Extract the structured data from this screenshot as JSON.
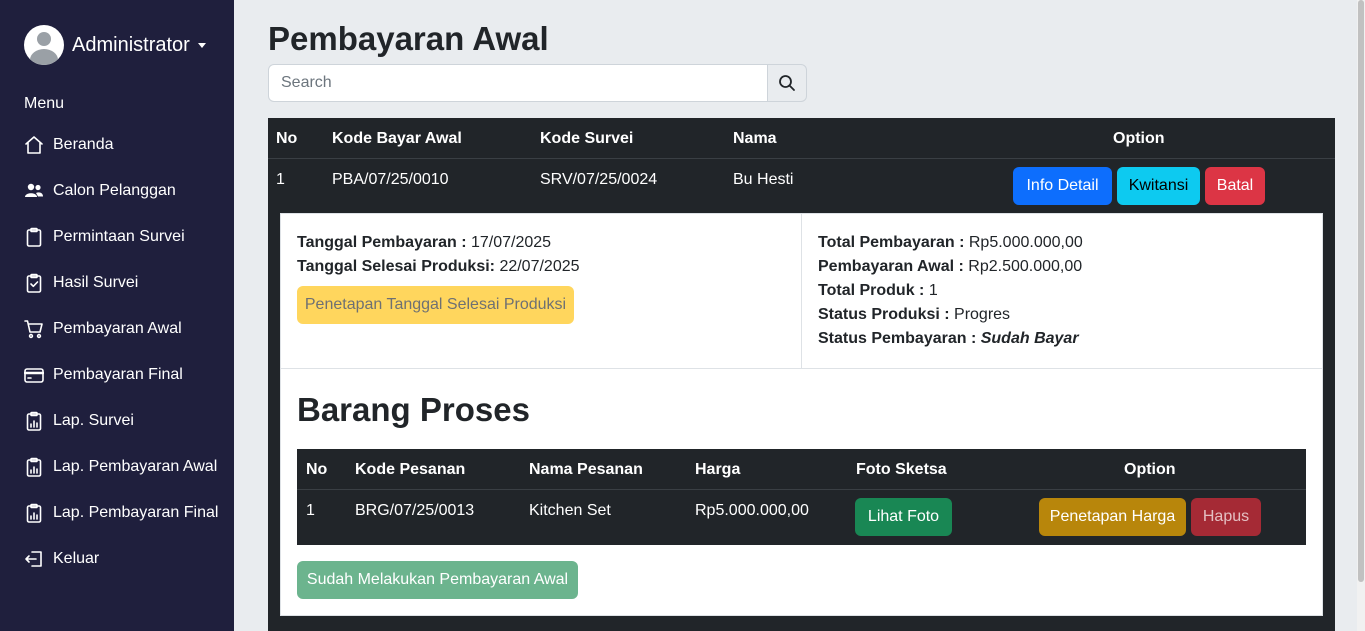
{
  "sidebar": {
    "user_name": "Administrator",
    "menu_title": "Menu",
    "items": [
      {
        "label": "Beranda",
        "icon": "home-icon"
      },
      {
        "label": "Calon Pelanggan",
        "icon": "people-icon"
      },
      {
        "label": "Permintaan Survei",
        "icon": "clipboard-icon"
      },
      {
        "label": "Hasil Survei",
        "icon": "clipboard-check-icon"
      },
      {
        "label": "Pembayaran Awal",
        "icon": "cart-icon"
      },
      {
        "label": "Pembayaran Final",
        "icon": "credit-card-icon"
      },
      {
        "label": "Lap. Survei",
        "icon": "report-icon"
      },
      {
        "label": "Lap. Pembayaran Awal",
        "icon": "report-icon"
      },
      {
        "label": "Lap. Pembayaran Final",
        "icon": "report-icon"
      },
      {
        "label": "Keluar",
        "icon": "logout-icon"
      }
    ]
  },
  "page": {
    "title": "Pembayaran Awal",
    "search_placeholder": "Search"
  },
  "main_table": {
    "headers": [
      "No",
      "Kode Bayar Awal",
      "Kode Survei",
      "Nama",
      "Option"
    ],
    "rows": [
      {
        "no": "1",
        "kode_bayar_awal": "PBA/07/25/0010",
        "kode_survei": "SRV/07/25/0024",
        "nama": "Bu Hesti"
      }
    ],
    "buttons": {
      "info_detail": "Info Detail",
      "kwitansi": "Kwitansi",
      "batal": "Batal"
    }
  },
  "detail": {
    "tanggal_pembayaran_label": "Tanggal Pembayaran :",
    "tanggal_pembayaran": "17/07/2025",
    "tanggal_selesai_label": "Tanggal Selesai Produksi:",
    "tanggal_selesai": "22/07/2025",
    "penetapan_tanggal_button": "Penetapan Tanggal Selesai Produksi",
    "total_pembayaran_label": "Total Pembayaran :",
    "total_pembayaran": "Rp5.000.000,00",
    "pembayaran_awal_label": "Pembayaran Awal :",
    "pembayaran_awal": "Rp2.500.000,00",
    "total_produk_label": "Total Produk :",
    "total_produk": "1",
    "status_produksi_label": "Status Produksi :",
    "status_produksi": "Progres",
    "status_pembayaran_label": "Status Pembayaran :",
    "status_pembayaran": "Sudah Bayar"
  },
  "barang": {
    "title": "Barang Proses",
    "headers": [
      "No",
      "Kode Pesanan",
      "Nama Pesanan",
      "Harga",
      "Foto Sketsa",
      "Option"
    ],
    "rows": [
      {
        "no": "1",
        "kode_pesanan": "BRG/07/25/0013",
        "nama_pesanan": "Kitchen Set",
        "harga": "Rp5.000.000,00"
      }
    ],
    "buttons": {
      "lihat_foto": "Lihat Foto",
      "penetapan_harga": "Penetapan Harga",
      "hapus": "Hapus"
    },
    "confirm_button": "Sudah Melakukan Pembayaran Awal"
  }
}
